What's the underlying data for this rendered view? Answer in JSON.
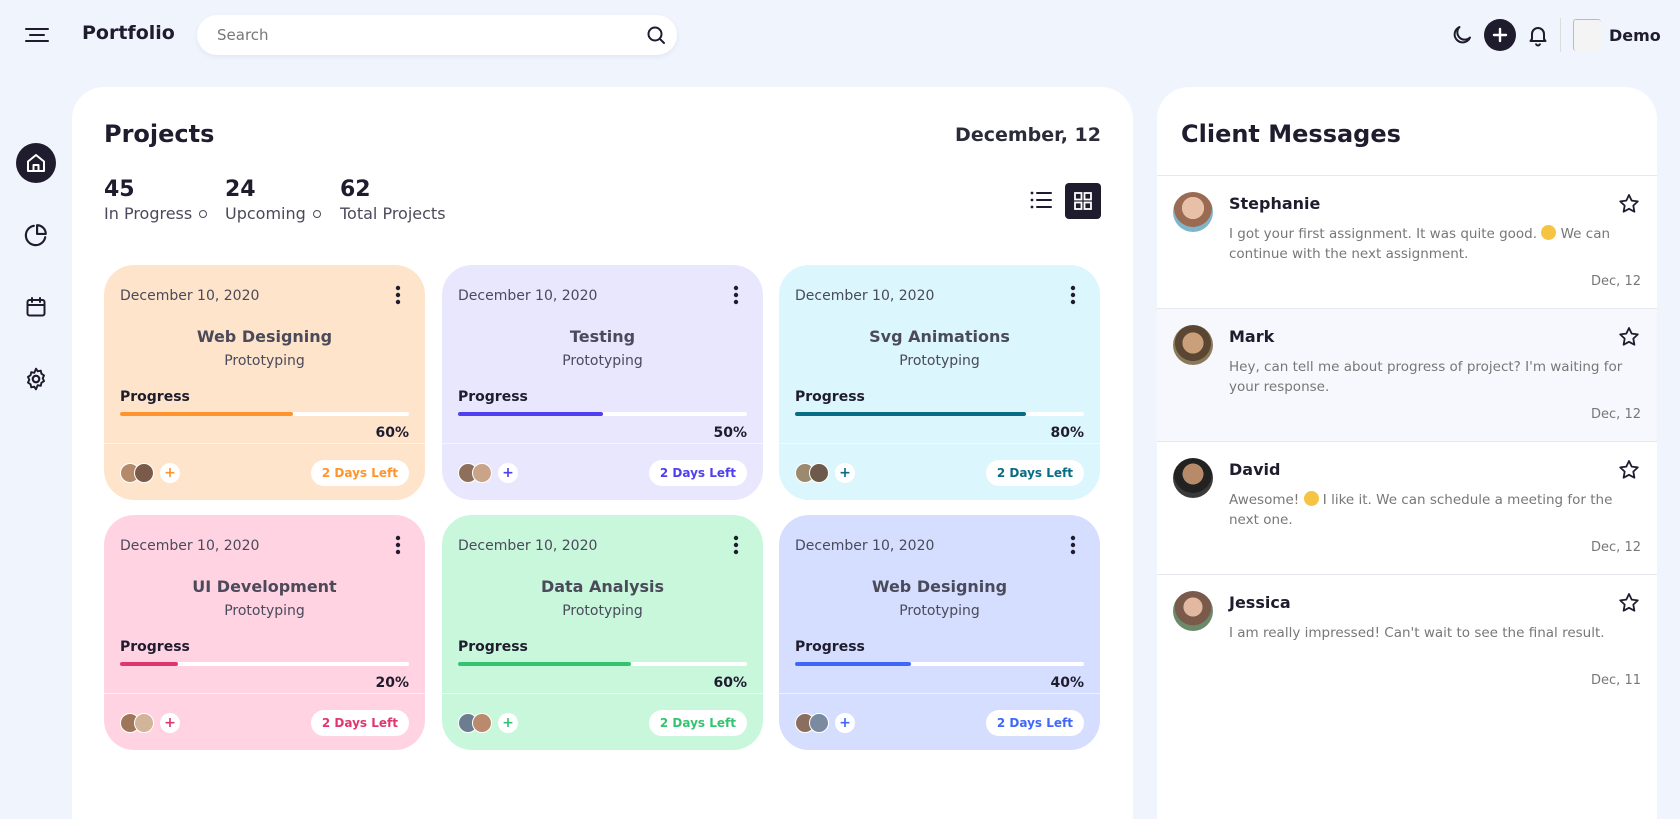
{
  "header": {
    "brand": "Portfolio",
    "search_placeholder": "Search",
    "profile_name": "Demo"
  },
  "sidebar": {
    "items": [
      {
        "name": "home",
        "active": true
      },
      {
        "name": "chart",
        "active": false
      },
      {
        "name": "calendar",
        "active": false
      },
      {
        "name": "settings",
        "active": false
      }
    ]
  },
  "projects": {
    "title": "Projects",
    "date": "December, 12",
    "stats": [
      {
        "number": "45",
        "label": "In Progress"
      },
      {
        "number": "24",
        "label": "Upcoming"
      },
      {
        "number": "62",
        "label": "Total Projects"
      }
    ],
    "progress_label": "Progress",
    "cards": [
      {
        "date": "December 10, 2020",
        "title": "Web Designing",
        "subtitle": "Prototyping",
        "progress": 60,
        "progress_text": "60%",
        "days_left": "2 Days Left",
        "bg": "#fee4cb",
        "accent": "#ff942e"
      },
      {
        "date": "December 10, 2020",
        "title": "Testing",
        "subtitle": "Prototyping",
        "progress": 50,
        "progress_text": "50%",
        "days_left": "2 Days Left",
        "bg": "#e9e7fd",
        "accent": "#4f3ff0"
      },
      {
        "date": "December 10, 2020",
        "title": "Svg Animations",
        "subtitle": "Prototyping",
        "progress": 80,
        "progress_text": "80%",
        "days_left": "2 Days Left",
        "bg": "#dbf6fd",
        "accent": "#096c86"
      },
      {
        "date": "December 10, 2020",
        "title": "UI Development",
        "subtitle": "Prototyping",
        "progress": 20,
        "progress_text": "20%",
        "days_left": "2 Days Left",
        "bg": "#ffd3e2",
        "accent": "#df3670"
      },
      {
        "date": "December 10, 2020",
        "title": "Data Analysis",
        "subtitle": "Prototyping",
        "progress": 60,
        "progress_text": "60%",
        "days_left": "2 Days Left",
        "bg": "#c8f7dc",
        "accent": "#34c471"
      },
      {
        "date": "December 10, 2020",
        "title": "Web Designing",
        "subtitle": "Prototyping",
        "progress": 40,
        "progress_text": "40%",
        "days_left": "2 Days Left",
        "bg": "#d5deff",
        "accent": "#4067f9"
      }
    ]
  },
  "messages": {
    "title": "Client Messages",
    "items": [
      {
        "name": "Stephanie",
        "text_before": "I got your first assignment. It was quite good.",
        "text_after": "We can continue with the next assignment.",
        "date": "Dec, 12",
        "highlight": false
      },
      {
        "name": "Mark",
        "text_before": "Hey, can tell me about progress of project? I'm waiting for your response.",
        "text_after": "",
        "date": "Dec, 12",
        "highlight": true
      },
      {
        "name": "David",
        "text_before": "Awesome!",
        "text_after": "I like it. We can schedule a meeting for the next one.",
        "date": "Dec, 12",
        "highlight": false
      },
      {
        "name": "Jessica",
        "text_before": "I am really impressed! Can't wait to see the final result.",
        "text_after": "",
        "date": "Dec, 11",
        "highlight": false
      }
    ]
  }
}
